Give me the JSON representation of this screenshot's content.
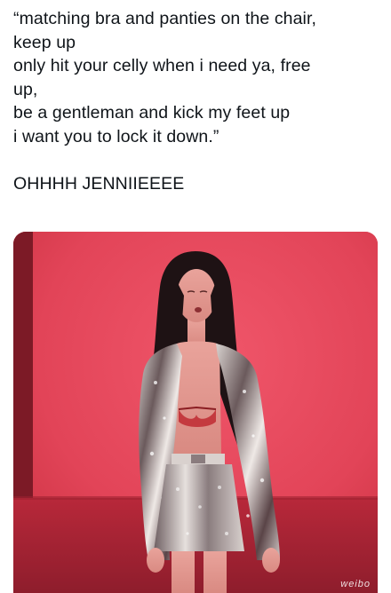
{
  "tweet": {
    "lines": [
      "“matching bra and panties on the chair,",
      "keep up",
      "only hit your celly when i need ya, free",
      "up,",
      "be a gentleman and kick my feet up",
      "i want you to lock it down.”"
    ],
    "caption": "OHHHH JENNIIEEEE"
  },
  "media": {
    "type": "photo",
    "subject": "performer-on-stage",
    "background_color": "#e4475a",
    "watermark": "weibo"
  }
}
